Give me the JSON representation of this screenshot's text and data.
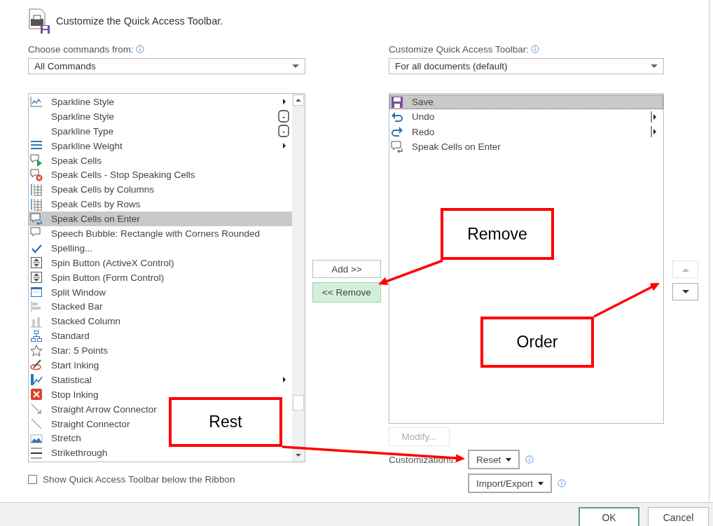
{
  "header": {
    "title": "Customize the Quick Access Toolbar."
  },
  "commands": {
    "label": "Choose commands from:",
    "source": "All Commands",
    "items": [
      {
        "label": "Sparkline Style",
        "kind": "submenu",
        "selected": false
      },
      {
        "label": "Sparkline Style",
        "kind": "dropdown",
        "selected": false
      },
      {
        "label": "Sparkline Type",
        "kind": "dropdown",
        "selected": false
      },
      {
        "label": "Sparkline Weight",
        "kind": "submenu",
        "selected": false
      },
      {
        "label": "Speak Cells",
        "kind": "plain",
        "selected": false
      },
      {
        "label": "Speak Cells - Stop Speaking Cells",
        "kind": "plain",
        "selected": false
      },
      {
        "label": "Speak Cells by Columns",
        "kind": "plain",
        "selected": false
      },
      {
        "label": "Speak Cells by Rows",
        "kind": "plain",
        "selected": false
      },
      {
        "label": "Speak Cells on Enter",
        "kind": "plain",
        "selected": true
      },
      {
        "label": "Speech Bubble: Rectangle with Corners Rounded",
        "kind": "plain",
        "selected": false
      },
      {
        "label": "Spelling...",
        "kind": "plain",
        "selected": false
      },
      {
        "label": "Spin Button (ActiveX Control)",
        "kind": "plain",
        "selected": false
      },
      {
        "label": "Spin Button (Form Control)",
        "kind": "plain",
        "selected": false
      },
      {
        "label": "Split Window",
        "kind": "plain",
        "selected": false
      },
      {
        "label": "Stacked Bar",
        "kind": "plain",
        "selected": false
      },
      {
        "label": "Stacked Column",
        "kind": "plain",
        "selected": false
      },
      {
        "label": "Standard",
        "kind": "plain",
        "selected": false
      },
      {
        "label": "Star: 5 Points",
        "kind": "plain",
        "selected": false
      },
      {
        "label": "Start Inking",
        "kind": "plain",
        "selected": false
      },
      {
        "label": "Statistical",
        "kind": "submenu",
        "selected": false
      },
      {
        "label": "Stop Inking",
        "kind": "plain",
        "selected": false
      },
      {
        "label": "Straight Arrow Connector",
        "kind": "plain",
        "selected": false
      },
      {
        "label": "Straight Connector",
        "kind": "plain",
        "selected": false
      },
      {
        "label": "Stretch",
        "kind": "plain",
        "selected": false
      },
      {
        "label": "Strikethrough",
        "kind": "plain",
        "selected": false
      }
    ]
  },
  "buttons": [
    {
      "label": "Add >>",
      "highlighted": false
    },
    {
      "label": "<< Remove",
      "highlighted": true
    }
  ],
  "toolbar": {
    "label": "Customize Quick Access Toolbar:",
    "scope": "For all documents (default)",
    "items": [
      {
        "label": "Save",
        "kind": "plain",
        "selected": true
      },
      {
        "label": "Undo",
        "kind": "split",
        "selected": false
      },
      {
        "label": "Redo",
        "kind": "split",
        "selected": false
      },
      {
        "label": "Speak Cells on Enter",
        "kind": "plain",
        "selected": false
      }
    ]
  },
  "order_buttons": [
    {
      "kind": "up",
      "disabled": true
    },
    {
      "kind": "down",
      "disabled": false
    }
  ],
  "modify_button": {
    "label": "Modify...",
    "disabled": true
  },
  "customizations": {
    "label": "Customizations:",
    "reset": "Reset",
    "import_export": "Import/Export"
  },
  "show_below_ribbon": {
    "label": "Show Quick Access Toolbar below the Ribbon",
    "checked": false
  },
  "footer": {
    "ok": "OK",
    "cancel": "Cancel"
  },
  "annotations": [
    {
      "text": "Remove"
    },
    {
      "text": "Order"
    },
    {
      "text": "Rest"
    }
  ]
}
